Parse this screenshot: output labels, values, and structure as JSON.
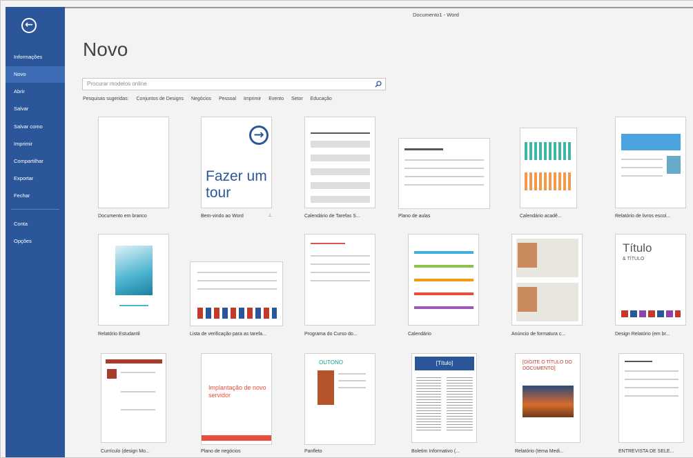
{
  "window_title": "Documento1 - Word",
  "page_title": "Novo",
  "sidebar": {
    "items": [
      {
        "label": "Informações"
      },
      {
        "label": "Novo"
      },
      {
        "label": "Abrir"
      },
      {
        "label": "Salvar"
      },
      {
        "label": "Salvar como"
      },
      {
        "label": "Imprimir"
      },
      {
        "label": "Compartilhar"
      },
      {
        "label": "Exportar"
      },
      {
        "label": "Fechar"
      },
      {
        "label": "Conta"
      },
      {
        "label": "Opções"
      }
    ],
    "active": "Novo",
    "accent": "#2b579a"
  },
  "search": {
    "placeholder": "Procurar modelos online"
  },
  "suggested": {
    "label": "Pesquisas sugeridas:",
    "items": [
      "Conjuntos de Designs",
      "Negócios",
      "Pessoal",
      "Imprimir",
      "Evento",
      "Setor",
      "Educação"
    ]
  },
  "templates": [
    {
      "name": "Documento em branco"
    },
    {
      "name": "Bem-vindo ao Word",
      "big_text": "Fazer um tour"
    },
    {
      "name": "Calendário de Tarefas S..."
    },
    {
      "name": "Plano de aulas"
    },
    {
      "name": "Calendário acadê..."
    },
    {
      "name": "Relatório de livros escol..."
    },
    {
      "name": "Relatório Estudantil"
    },
    {
      "name": "Lista de verificação para as tarefa..."
    },
    {
      "name": "Programa do Curso do..."
    },
    {
      "name": "Calendário"
    },
    {
      "name": "Anúncio de formatura c..."
    },
    {
      "name": "Design Relatório (em br...",
      "big_text": "Título",
      "sub_text": "& TÍTULO"
    },
    {
      "name": "Currículo (design Mo..."
    },
    {
      "name": "Plano de negócios",
      "big_text": "Implantação de novo servidor"
    },
    {
      "name": "Panfleto",
      "big_text": "OUTONO"
    },
    {
      "name": "Boletim Informativo (...",
      "big_text": "[Título]"
    },
    {
      "name": "Relatório (tema Medi...",
      "big_text": "[DIGITE O TÍTULO DO DOCUMENTO]"
    },
    {
      "name": "ENTREVISTA DE SELE..."
    }
  ]
}
